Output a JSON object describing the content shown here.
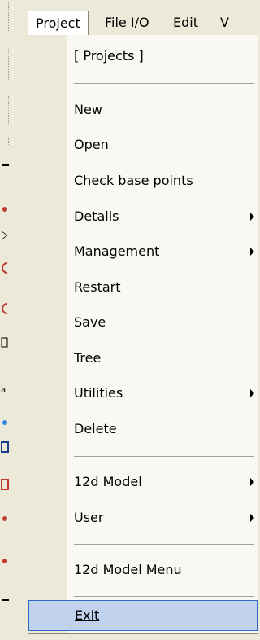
{
  "menubar": {
    "items": [
      {
        "label": "Project",
        "accel": "j"
      },
      {
        "label": "File I/O",
        "accel": "F"
      },
      {
        "label": "Edit",
        "accel": "E"
      },
      {
        "label": "V",
        "accel": "V"
      }
    ]
  },
  "menu": {
    "header": "[ Projects ]",
    "items": [
      {
        "label": "New"
      },
      {
        "label": "Open"
      },
      {
        "label": "Check base points"
      },
      {
        "label": "Details",
        "submenu": true
      },
      {
        "label": "Management",
        "submenu": true
      },
      {
        "label": "Restart"
      },
      {
        "label": "Save"
      },
      {
        "label": "Tree"
      },
      {
        "label": "Utilities",
        "submenu": true
      },
      {
        "label": "Delete"
      }
    ],
    "group2": [
      {
        "label": "12d Model",
        "submenu": true
      },
      {
        "label": "User",
        "submenu": true
      }
    ],
    "group3": [
      {
        "label": "12d Model Menu"
      }
    ],
    "exit": {
      "label": "Exit",
      "accel": "E"
    }
  }
}
